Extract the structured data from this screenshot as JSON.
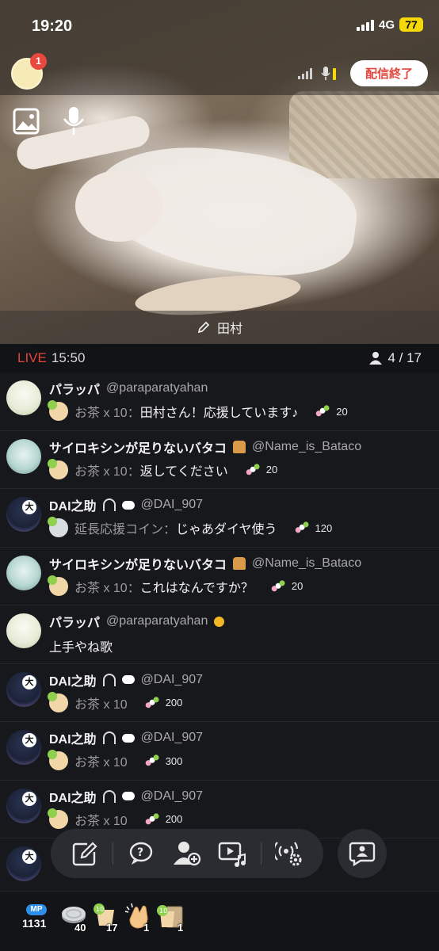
{
  "status_bar": {
    "time": "19:20",
    "network": "4G",
    "battery": "77"
  },
  "header": {
    "notification_count": "1",
    "end_button": "配信終了"
  },
  "stream": {
    "title_name": "田村"
  },
  "live_bar": {
    "live_label": "LIVE",
    "elapsed": "15:50",
    "viewers": "4 / 17"
  },
  "comments": [
    {
      "user": "パラッパ",
      "handle": "@paraparatyahan",
      "gift": "お茶 x 10：",
      "message": "田村さん！応援しています♪",
      "points": "20",
      "avatar": "green"
    },
    {
      "user": "サイロキシンが足りないバタコ",
      "handle": "@Name_is_Bataco",
      "gift": "お茶 x 10：",
      "message": "返してください",
      "points": "20",
      "avatar": "blue"
    },
    {
      "user": "DAI之助",
      "handle": "@DAI_907",
      "gift": "延長応援コイン：",
      "message": "じゃあダイヤ使う",
      "points": "120",
      "avatar": "dark"
    },
    {
      "user": "サイロキシンが足りないバタコ",
      "handle": "@Name_is_Bataco",
      "gift": "お茶 x 10：",
      "message": "これはなんですか？",
      "points": "20",
      "avatar": "blue"
    },
    {
      "user": "パラッパ",
      "handle": "@paraparatyahan",
      "message": "上手やね歌",
      "avatar": "green"
    },
    {
      "user": "DAI之助",
      "handle": "@DAI_907",
      "gift": "お茶 x 10",
      "points": "200",
      "avatar": "dark"
    },
    {
      "user": "DAI之助",
      "handle": "@DAI_907",
      "gift": "お茶 x 10",
      "points": "300",
      "avatar": "dark"
    },
    {
      "user": "DAI之助",
      "handle": "@DAI_907",
      "gift": "お茶 x 10",
      "points": "200",
      "avatar": "dark"
    }
  ],
  "bottom_bar": {
    "mp_label": "MP",
    "mp_value": "1131",
    "coin_count": "40",
    "tea_count": "17",
    "clap_count": "1",
    "box_count": "1"
  },
  "icons": {
    "image": "image-icon",
    "mic": "microphone-icon",
    "edit": "pencil-icon",
    "viewers": "person-icon",
    "action_bar": [
      "edit-note-icon",
      "question-chat-icon",
      "add-user-icon",
      "video-music-icon",
      "broadcast-settings-icon"
    ],
    "chat": "chat-profile-icon"
  },
  "colors": {
    "live": "#e2453c",
    "battery": "#f5d90a",
    "end_button_text": "#e2453c",
    "mp": "#2f8ee8"
  }
}
